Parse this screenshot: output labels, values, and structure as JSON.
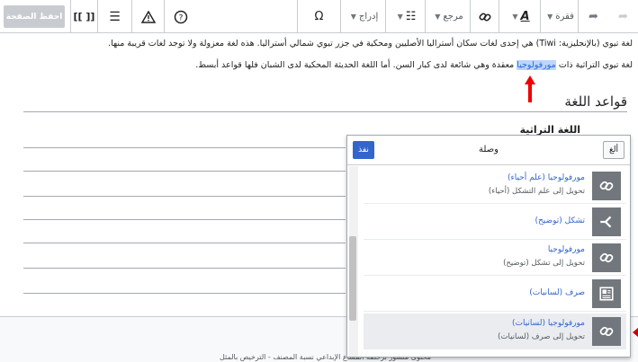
{
  "toolbar": {
    "save_label": "احفظ الصفحة",
    "paragraph_label": "فقرة",
    "cite_label": "مرجع",
    "insert_label": "إدراج",
    "special_char": "Ω",
    "format_text": "A"
  },
  "article": {
    "p1": "لغة تيوي (بالإنجليزية: Tiwi) هي إحدى لغات سكان أستراليا الأصليين ومحكية في جزر تيوي شمالي أستراليا. هذه لغة معزولة ولا توجد لغات قريبة منها.",
    "p2_before": "لغة تيوي التراثية ذات",
    "p2_highlight": "مورفولوجيا",
    "p2_after": "معقدة وهي شائعة لدى كبار السن. أما اللغة الحديثة المحكية لدى الشبان فلها قواعد أبسط.",
    "heading": "قواعد اللغة",
    "subheading": "اللغة التراثية"
  },
  "dialog": {
    "title": "وصلة",
    "done_label": "نفذ",
    "cancel_label": "ألغ",
    "results": [
      {
        "title": "مورفولوجيا (علم أحياء)",
        "desc": "تحويل إلى علم التشكل (أحياء)",
        "icon": "redirect-icon"
      },
      {
        "title": "تشكل (توضيح)",
        "desc": "",
        "icon": "disambiguation-icon"
      },
      {
        "title": "مورفولوجيا",
        "desc": "تحويل إلى تشكل (توضيح)",
        "icon": "redirect-icon"
      },
      {
        "title": "صرف (لسانيات)",
        "desc": "",
        "icon": "article-icon"
      },
      {
        "title": "مورفولوجيا (لسانيات)",
        "desc": "تحويل إلى صرف (لسانيات)",
        "icon": "redirect-icon"
      }
    ]
  },
  "footer": {
    "text": "محتوى منشور برخصة المشاع الإبداعي نسبة المصنف - الترخيص بالمثل"
  },
  "colors": {
    "accent": "#3366cc",
    "highlight": "#bad6ff",
    "annotation": "#cc0000"
  }
}
